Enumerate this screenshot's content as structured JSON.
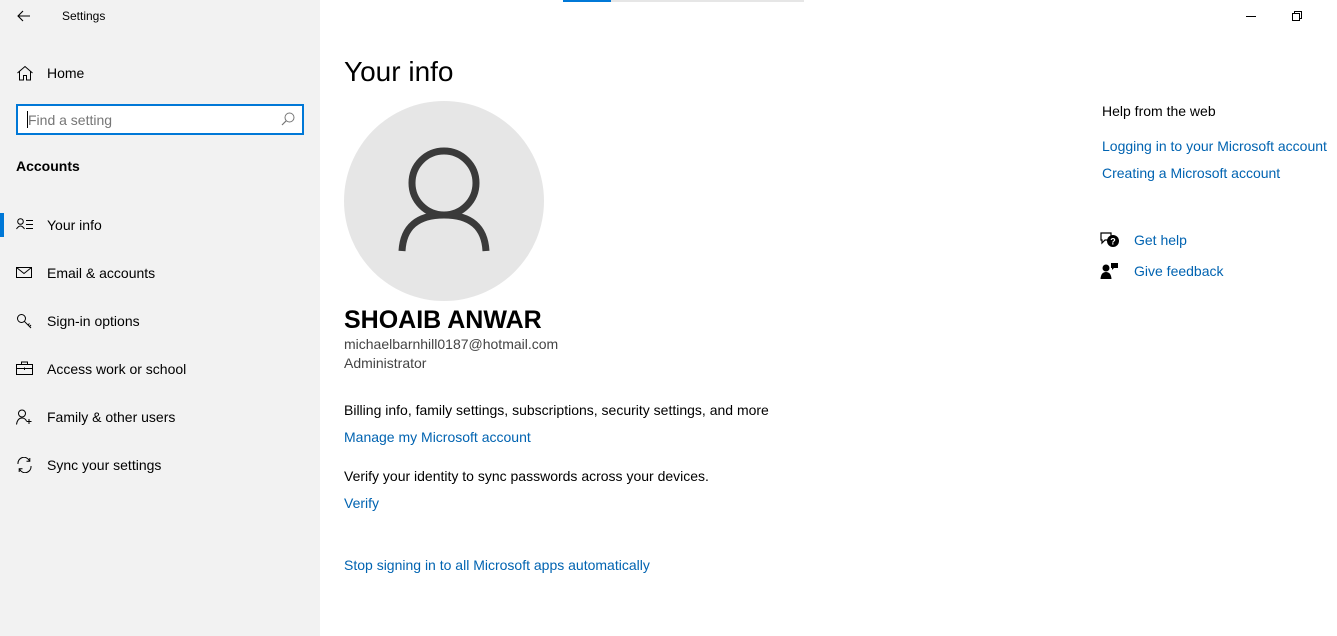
{
  "window": {
    "title": "Settings",
    "back_icon": "back-arrow-icon",
    "minimize_icon": "minimize-icon",
    "restore_icon": "restore-icon",
    "loading_progress": 0.2
  },
  "sidebar": {
    "home_label": "Home",
    "search_placeholder": "Find a setting",
    "section_title": "Accounts",
    "items": [
      {
        "label": "Your info",
        "icon": "contact-card-icon",
        "selected": true
      },
      {
        "label": "Email & accounts",
        "icon": "mail-icon",
        "selected": false
      },
      {
        "label": "Sign-in options",
        "icon": "key-icon",
        "selected": false
      },
      {
        "label": "Access work or school",
        "icon": "briefcase-icon",
        "selected": false
      },
      {
        "label": "Family & other users",
        "icon": "person-add-icon",
        "selected": false
      },
      {
        "label": "Sync your settings",
        "icon": "sync-icon",
        "selected": false
      }
    ]
  },
  "main": {
    "title": "Your info",
    "user_name": "SHOAIB ANWAR",
    "email": "michaelbarnhill0187@hotmail.com",
    "role": "Administrator",
    "billing_text": "Billing info, family settings, subscriptions, security settings, and more",
    "manage_link": "Manage my Microsoft account",
    "verify_text": "Verify your identity to sync passwords across your devices.",
    "verify_link": "Verify",
    "stop_link": "Stop signing in to all Microsoft apps automatically"
  },
  "help": {
    "title": "Help from the web",
    "links": [
      "Logging in to your Microsoft account",
      "Creating a Microsoft account"
    ],
    "get_help": "Get help",
    "give_feedback": "Give feedback"
  },
  "colors": {
    "accent": "#0078d7",
    "link": "#0063b1",
    "sidebar_bg": "#f2f2f2",
    "avatar_bg": "#e6e6e6"
  }
}
